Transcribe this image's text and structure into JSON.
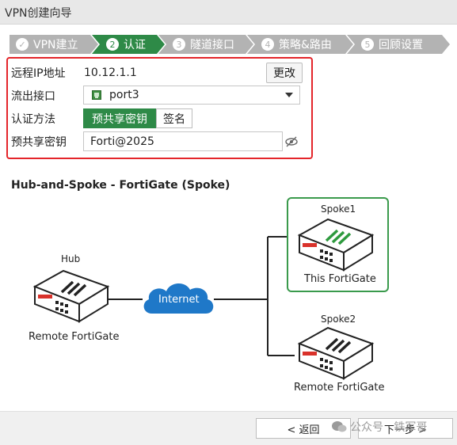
{
  "window": {
    "title": "VPN创建向导"
  },
  "steps": [
    {
      "num": "✓",
      "label": "VPN建立"
    },
    {
      "num": "2",
      "label": "认证"
    },
    {
      "num": "3",
      "label": "隧道接口"
    },
    {
      "num": "4",
      "label": "策略&路由"
    },
    {
      "num": "5",
      "label": "回顾设置"
    }
  ],
  "form": {
    "remote_ip": {
      "label": "远程IP地址",
      "value": "10.12.1.1",
      "change_button": "更改"
    },
    "outgoing_interface": {
      "label": "流出接口",
      "value": "port3"
    },
    "auth_method": {
      "label": "认证方法",
      "option_psk": "预共享密钥",
      "option_sig": "签名"
    },
    "psk": {
      "label": "预共享密钥",
      "value": "Forti@2025"
    }
  },
  "diagram": {
    "title": "Hub-and-Spoke - FortiGate (Spoke)",
    "hub": {
      "title": "Hub",
      "caption": "Remote FortiGate"
    },
    "cloud_label": "Internet",
    "spoke1": {
      "title": "Spoke1",
      "caption": "This FortiGate"
    },
    "spoke2": {
      "title": "Spoke2",
      "caption": "Remote FortiGate"
    }
  },
  "footer": {
    "back_button": "< 返回",
    "next_button": "下一步 >",
    "watermark": "公众号 · 铁军哥"
  },
  "colors": {
    "active_step": "#2e8a47",
    "inactive_step": "#b3b3b3",
    "highlight_border": "#e4252a",
    "spoke1_border": "#3a9a4c",
    "cloud": "#1f78c8"
  }
}
